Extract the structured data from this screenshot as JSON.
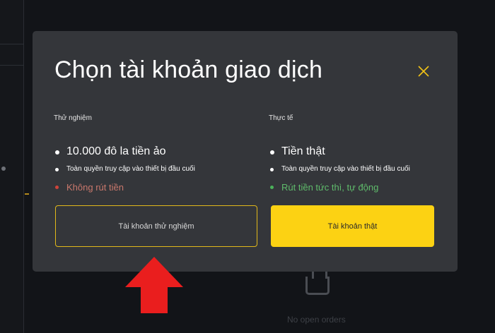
{
  "background": {
    "empty_state_text": "No open orders"
  },
  "modal": {
    "title": "Chọn tài khoản giao dịch",
    "close_icon": "close-icon",
    "accent_color": "#fcd213",
    "demo": {
      "heading": "Thử nghiệm",
      "balance": "10.000 đô la tiền ảo",
      "access": "Toàn quyền truy cập vào thiết bị đầu cuối",
      "withdraw": "Không rút tiền",
      "button_label": "Tài khoản thử nghiệm"
    },
    "real": {
      "heading": "Thực tế",
      "balance": "Tiền thật",
      "access": "Toàn quyền truy cập vào thiết bị đầu cuối",
      "withdraw": "Rút tiền tức thì, tự động",
      "button_label": "Tài khoản thật"
    }
  },
  "annotation": {
    "icon": "red-arrow-up-icon",
    "color": "#ea1e1e"
  }
}
